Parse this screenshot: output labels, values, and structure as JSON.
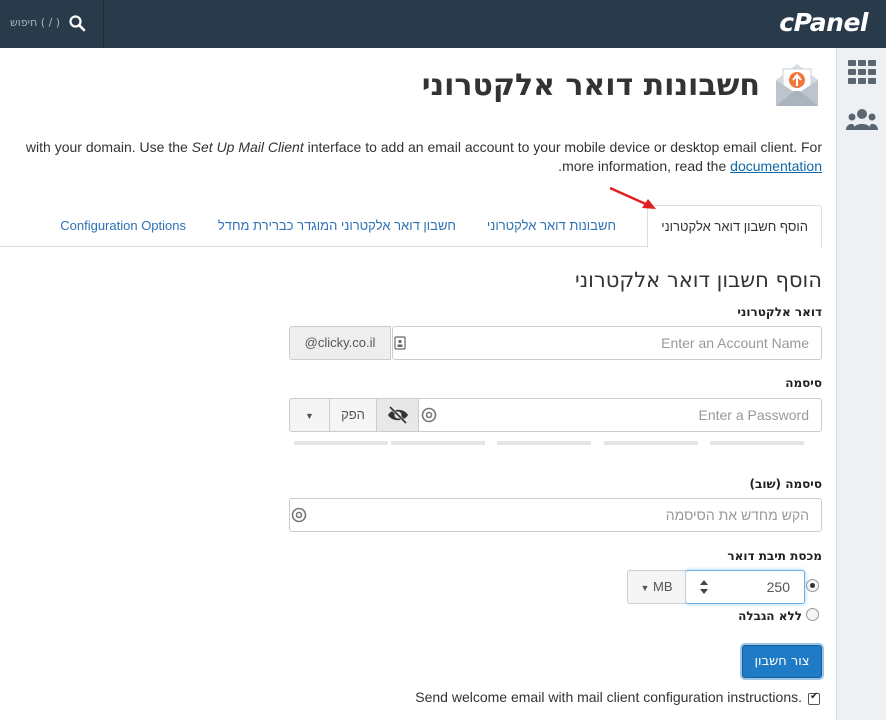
{
  "topbar": {
    "logo": "cPanel",
    "search_label": "חיפוש ( / )"
  },
  "sidebar": {
    "items": [
      {
        "name": "grid-icon"
      },
      {
        "name": "users-icon"
      }
    ]
  },
  "page": {
    "title": "חשבונות דואר אלקטרוני",
    "intro_line1_pre": "with your domain. Use the ",
    "intro_line1_em": "Set Up Mail Client",
    "intro_line1_post": " interface to add an email account to your mobile device or desktop email client. For",
    "intro_line2_pre": "more information, read the ",
    "intro_line2_link": "documentation",
    "intro_line2_post": "."
  },
  "tabs": [
    {
      "label": "הוסף חשבון דואר אלקטרוני",
      "active": true
    },
    {
      "label": "חשבונות דואר אלקטרוני",
      "active": false
    },
    {
      "label": "חשבון דואר אלקטרוני המוגדר כברירת מחדל",
      "active": false
    },
    {
      "label": "Configuration Options",
      "active": false
    }
  ],
  "form": {
    "title": "הוסף חשבון דואר אלקטרוני",
    "email_label": "דואר אלקטרוני",
    "email_placeholder": "Enter an Account Name",
    "domain": "@clicky.co.il",
    "password_label": "סיסמה",
    "password_placeholder": "Enter a Password",
    "generate_label": "הפק",
    "password_strength_segments": 5,
    "password_again_label": "סיסמה (שוב)",
    "password_again_placeholder": "הקש מחדש את הסיסמה",
    "quota_label": "מכסת תיבת דואר",
    "quota_value": "250",
    "quota_unit": "MB",
    "unlimited_label": "ללא הגבלה",
    "create_button": "צור חשבון",
    "welcome_email_label": "Send welcome email with mail client configuration instructions.",
    "welcome_email_checked": true
  },
  "colors": {
    "topbar": "#293a4a",
    "link": "#2e72b5",
    "primary_button": "#1f7bc6",
    "annotation_arrow": "#e02020"
  }
}
